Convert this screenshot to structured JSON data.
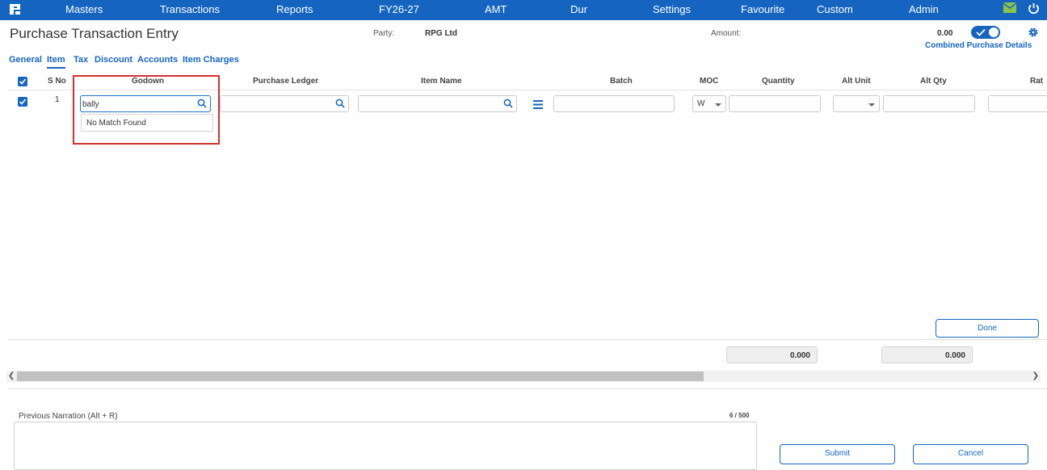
{
  "topnav": {
    "items": [
      "Masters",
      "Transactions",
      "Reports",
      "FY26-27",
      "AMT",
      "Dur",
      "Settings",
      "Favourite",
      "Custom",
      "Admin"
    ],
    "colors": {
      "bar": "#1565c0",
      "mail_icon": "#8bc34a"
    }
  },
  "header": {
    "title": "Purchase Transaction Entry",
    "party_label": "Party:",
    "party_value": "RPG Ltd",
    "amount_label": "Amount:",
    "amount_value": "0.00",
    "combined_link": "Combined Purchase Details",
    "toggle_on": true
  },
  "tabs": [
    "General",
    "Item",
    "Tax",
    "Discount",
    "Accounts",
    "Item Charges"
  ],
  "active_tab": "Item",
  "columns": [
    "S No",
    "Godown",
    "Purchase Ledger",
    "Item Name",
    "Batch",
    "MOC",
    "Quantity",
    "Alt Unit",
    "Alt Qty",
    "Rat"
  ],
  "row": {
    "s_no": "1",
    "godown_value": "bally",
    "godown_dropdown": "No Match Found",
    "moc_value": "W"
  },
  "buttons": {
    "done": "Done",
    "submit": "Submit",
    "cancel": "Cancel"
  },
  "totals": {
    "quantity": "0.000",
    "alt_qty": "0.000"
  },
  "narration": {
    "label": "Previous Narration (Alt + R)",
    "counter": "6 / 500"
  }
}
